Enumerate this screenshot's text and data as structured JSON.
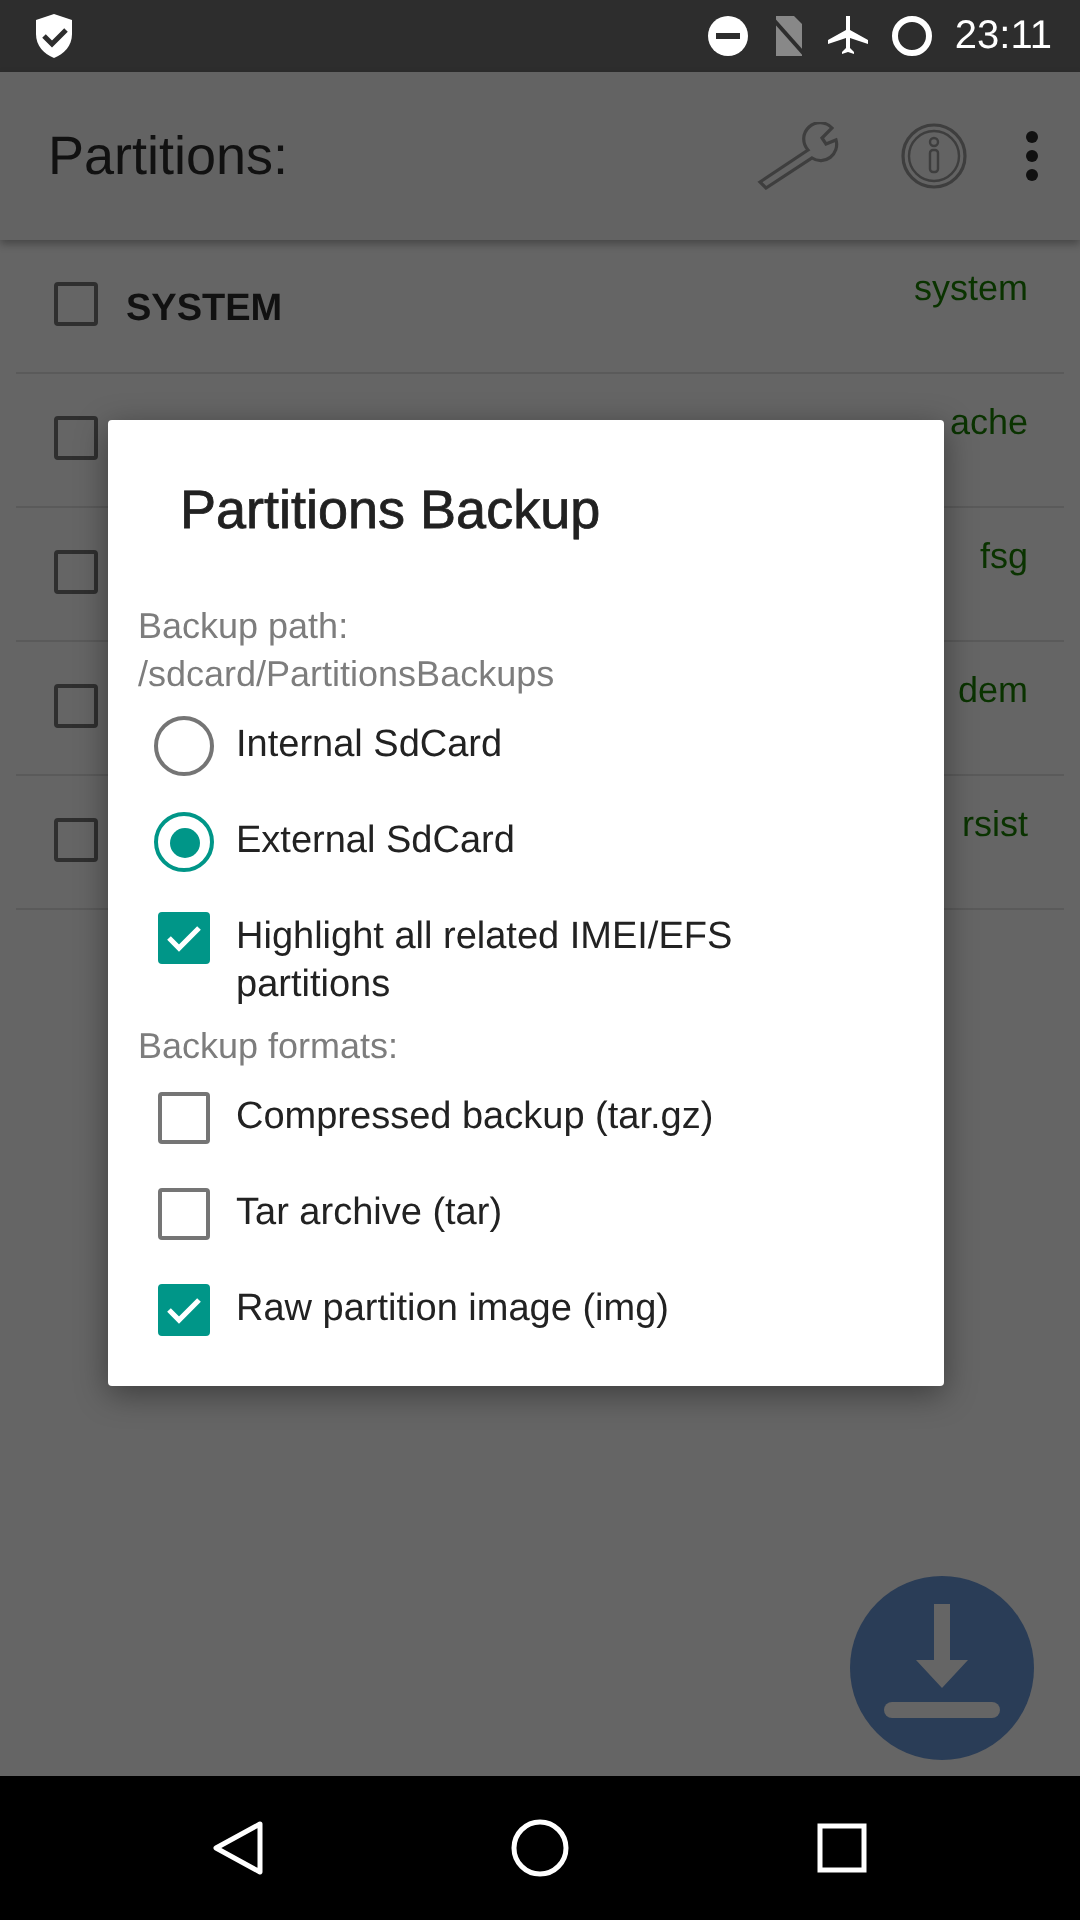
{
  "status_bar": {
    "time": "23:11"
  },
  "app_bar": {
    "title": "Partitions:"
  },
  "partitions": [
    {
      "label": "SYSTEM",
      "mount": "system",
      "checked": false
    },
    {
      "mount": "ache",
      "checked": false
    },
    {
      "mount": "fsg",
      "checked": false
    },
    {
      "mount": "dem",
      "checked": false
    },
    {
      "mount": "rsist",
      "checked": false
    }
  ],
  "dialog": {
    "title": "Partitions Backup",
    "sections": [
      {
        "heading": "Backup path:\n/sdcard/PartitionsBackups",
        "options": [
          {
            "kind": "radio",
            "label": "Internal SdCard",
            "selected": false
          },
          {
            "kind": "radio",
            "label": "External SdCard",
            "selected": true
          },
          {
            "kind": "checkbox",
            "label": "Highlight all related IMEI/EFS partitions",
            "checked": true
          }
        ]
      },
      {
        "heading": "Backup formats:",
        "options": [
          {
            "kind": "checkbox",
            "label": "Compressed backup (tar.gz)",
            "checked": false
          },
          {
            "kind": "checkbox",
            "label": "Tar archive (tar)",
            "checked": false
          },
          {
            "kind": "checkbox",
            "label": "Raw partition image (img)",
            "checked": true
          }
        ]
      }
    ]
  }
}
